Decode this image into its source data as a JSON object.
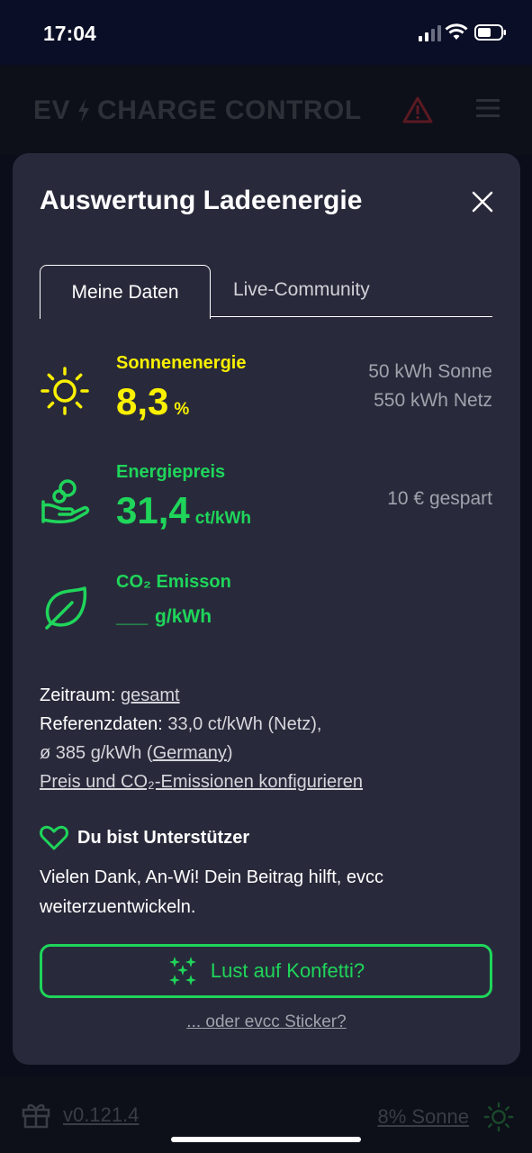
{
  "status": {
    "time": "17:04"
  },
  "appbar": {
    "brand_left": "EV",
    "brand_right": "CHARGE CONTROL"
  },
  "modal": {
    "title": "Auswertung Ladeenergie",
    "tabs": [
      {
        "label": "Meine Daten",
        "active": true
      },
      {
        "label": "Live-Community",
        "active": false
      }
    ],
    "solar": {
      "label": "Sonnenenergie",
      "value": "8,3",
      "unit": "%",
      "right_line1": "50 kWh Sonne",
      "right_line2": "550 kWh Netz"
    },
    "price": {
      "label": "Energiepreis",
      "value": "31,4",
      "unit": "ct/kWh",
      "right_line1": "10 € gespart"
    },
    "co2": {
      "label": "CO₂ Emisson",
      "value": "___",
      "unit": "g/kWh"
    },
    "info": {
      "period_label": "Zeitraum:",
      "period_value": "gesamt",
      "reference_label": "Referenzdaten:",
      "reference_value": "33,0 ct/kWh (Netz),",
      "avg_prefix": "ø 385 g/kWh (",
      "region": "Germany",
      "avg_suffix": ")",
      "configure_link": "Preis und CO₂-Emissionen konfigurieren"
    },
    "supporter": {
      "title": "Du bist Unterstützer",
      "message": "Vielen Dank, An-Wi! Dein Beitrag hilft, evcc weiterzuentwickeln."
    },
    "confetti_button": "Lust auf Konfetti?",
    "sticker_link": "... oder evcc Sticker?"
  },
  "footer": {
    "version": "v0.121.4",
    "sun_share": "8% Sonne"
  },
  "colors": {
    "accent_green": "#1fd55a",
    "solar_yellow": "#faf000",
    "modal_bg": "#282a3b"
  }
}
